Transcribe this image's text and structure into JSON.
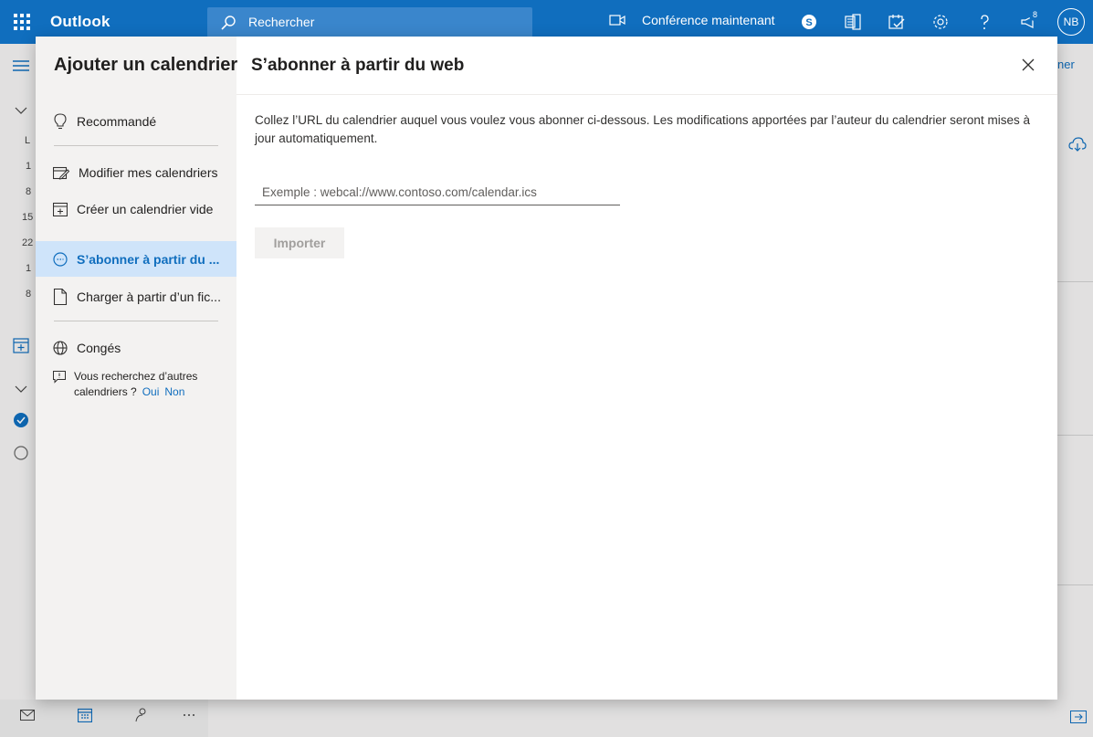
{
  "topbar": {
    "app_name": "Outlook",
    "search_placeholder": "Rechercher",
    "meet_now_label": "Conférence maintenant",
    "notification_count": "8",
    "avatar_initials": "NB"
  },
  "background": {
    "weekday_letter": "L",
    "dates": [
      "1",
      "8",
      "15",
      "22",
      "1",
      "8"
    ],
    "right_partial_text": "ner"
  },
  "dialog": {
    "nav_title": "Ajouter un calendrier",
    "nav_items": [
      {
        "label": "Recommandé",
        "icon": "lightbulb-icon"
      },
      {
        "label": "Modifier mes calendriers",
        "icon": "edit-calendar-icon"
      },
      {
        "label": "Créer un calendrier vide",
        "icon": "add-calendar-icon"
      },
      {
        "label": "S’abonner à partir du ...",
        "icon": "subscribe-icon",
        "active": true
      },
      {
        "label": "Charger à partir d’un fic...",
        "icon": "file-icon"
      },
      {
        "label": "Congés",
        "icon": "globe-icon"
      }
    ],
    "feedback": {
      "question": "Vous recherchez d’autres calendriers ?",
      "yes": "Oui",
      "no": "Non"
    },
    "main_title": "S’abonner à partir du web",
    "description": "Collez l’URL du calendrier auquel vous voulez vous abonner ci-dessous. Les modifications apportées par l’auteur du calendrier seront mises à jour automatiquement.",
    "url_input": {
      "value": "",
      "placeholder": "Exemple : webcal://www.contoso.com/calendar.ics"
    },
    "import_label": "Importer"
  },
  "colors": {
    "brand_blue": "#106ebe",
    "active_nav_bg": "#cfe4fa",
    "nav_bg": "#f3f2f1"
  }
}
